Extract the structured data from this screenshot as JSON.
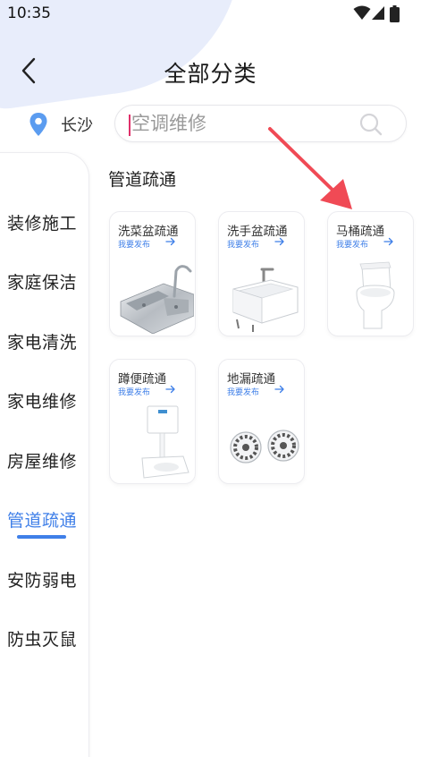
{
  "status_bar": {
    "time": "10:35",
    "icons": [
      "wifi-icon",
      "cellular-icon",
      "battery-icon"
    ]
  },
  "header": {
    "back_icon": "chevron-left-icon",
    "title": "全部分类"
  },
  "location": {
    "icon": "map-pin-icon",
    "city": "长沙",
    "icon_color": "#5b9cf0"
  },
  "search": {
    "placeholder": "空调维修",
    "value": "",
    "icon": "search-icon"
  },
  "sidebar": {
    "items": [
      {
        "label": "装修施工",
        "active": false
      },
      {
        "label": "家庭保洁",
        "active": false
      },
      {
        "label": "家电清洗",
        "active": false
      },
      {
        "label": "家电维修",
        "active": false
      },
      {
        "label": "房屋维修",
        "active": false
      },
      {
        "label": "管道疏通",
        "active": true
      },
      {
        "label": "安防弱电",
        "active": false
      },
      {
        "label": "防虫灭鼠",
        "active": false
      }
    ]
  },
  "main": {
    "section_title": "管道疏通",
    "cards": [
      {
        "title": "洗菜盆疏通",
        "subtitle": "我要发布",
        "image": "kitchen-sink-image"
      },
      {
        "title": "洗手盆疏通",
        "subtitle": "我要发布",
        "image": "wash-basin-image"
      },
      {
        "title": "马桶疏通",
        "subtitle": "我要发布",
        "image": "toilet-image"
      },
      {
        "title": "蹲便疏通",
        "subtitle": "我要发布",
        "image": "squat-toilet-image"
      },
      {
        "title": "地漏疏通",
        "subtitle": "我要发布",
        "image": "floor-drain-image"
      }
    ]
  },
  "colors": {
    "accent": "#3f7fe8",
    "caret": "#e0306a",
    "annotation_arrow": "#f04a55",
    "header_blob": "#e8edfb"
  }
}
